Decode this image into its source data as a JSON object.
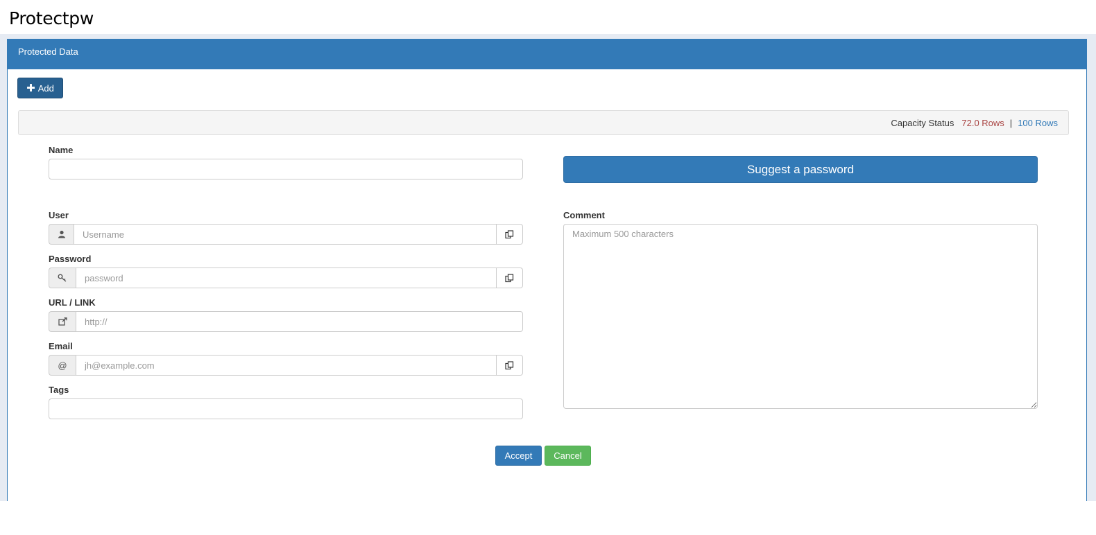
{
  "app": {
    "title": "Protectpw"
  },
  "panel": {
    "heading": "Protected Data"
  },
  "toolbar": {
    "add_label": "Add",
    "add_icon": "plus-icon"
  },
  "capacity": {
    "label": "Capacity Status",
    "used": "72.0 Rows",
    "separator": "|",
    "total": "100 Rows",
    "used_color": "#a94442",
    "total_color": "#337ab7"
  },
  "form": {
    "name": {
      "label": "Name",
      "value": ""
    },
    "user": {
      "label": "User",
      "placeholder": "Username",
      "icon": "user-icon",
      "copy_icon": "copy-icon"
    },
    "password": {
      "label": "Password",
      "placeholder": "password",
      "icon": "key-icon",
      "copy_icon": "copy-icon"
    },
    "url": {
      "label": "URL / LINK",
      "placeholder": "http://",
      "icon": "external-link-icon"
    },
    "email": {
      "label": "Email",
      "placeholder": "jh@example.com",
      "icon": "at-symbol",
      "icon_text": "@",
      "copy_icon": "copy-icon"
    },
    "tags": {
      "label": "Tags",
      "value": ""
    },
    "comment": {
      "label": "Comment",
      "placeholder": "Maximum 500 characters"
    },
    "suggest_label": "Suggest a password",
    "accept_label": "Accept",
    "cancel_label": "Cancel"
  },
  "colors": {
    "primary": "#337ab7",
    "success": "#5cb85c",
    "dark_primary": "#286090"
  }
}
